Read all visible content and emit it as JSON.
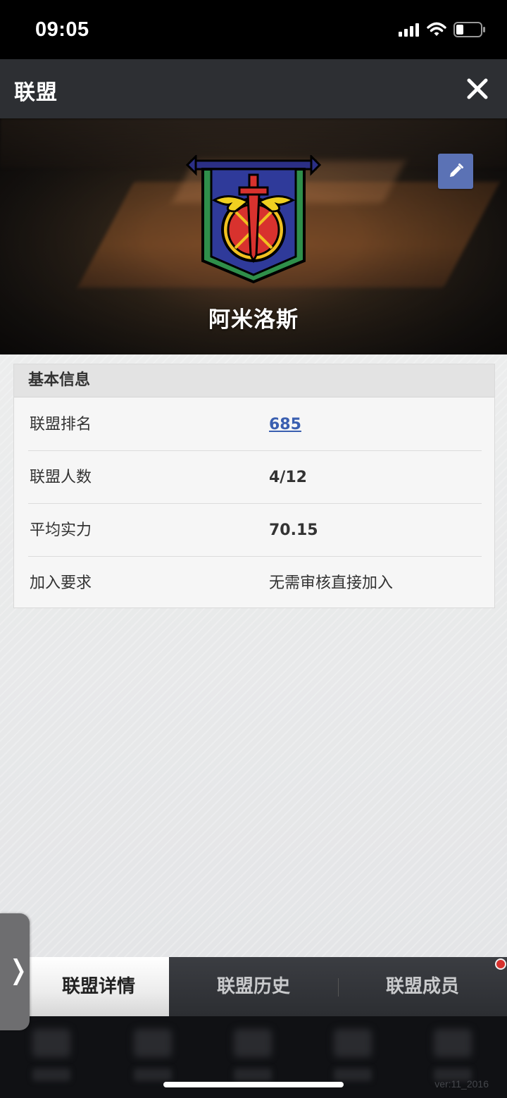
{
  "status_bar": {
    "time": "09:05"
  },
  "header": {
    "title": "联盟"
  },
  "league": {
    "name": "阿米洛斯"
  },
  "info_card": {
    "title": "基本信息",
    "rows": [
      {
        "label": "联盟排名",
        "value": "685"
      },
      {
        "label": "联盟人数",
        "value": "4/12"
      },
      {
        "label": "平均实力",
        "value": "70.15"
      },
      {
        "label": "加入要求",
        "value": "无需审核直接加入"
      }
    ]
  },
  "tabs": [
    {
      "label": "联盟详情",
      "active": true
    },
    {
      "label": "联盟历史",
      "active": false
    },
    {
      "label": "联盟成员",
      "active": false
    }
  ],
  "side_handle": {
    "arrow": "❭"
  },
  "footer": {
    "version": "ver:11_2016"
  },
  "colors": {
    "header_bg": "#2d2f33",
    "edit_button": "#5b72b5",
    "link": "#3a5fb0",
    "notification_dot": "#d8322e"
  },
  "icons": {
    "close": "close-icon",
    "edit": "pencil-icon",
    "signal": "signal-icon",
    "wifi": "wifi-icon",
    "battery": "battery-icon",
    "emblem": "league-emblem"
  }
}
